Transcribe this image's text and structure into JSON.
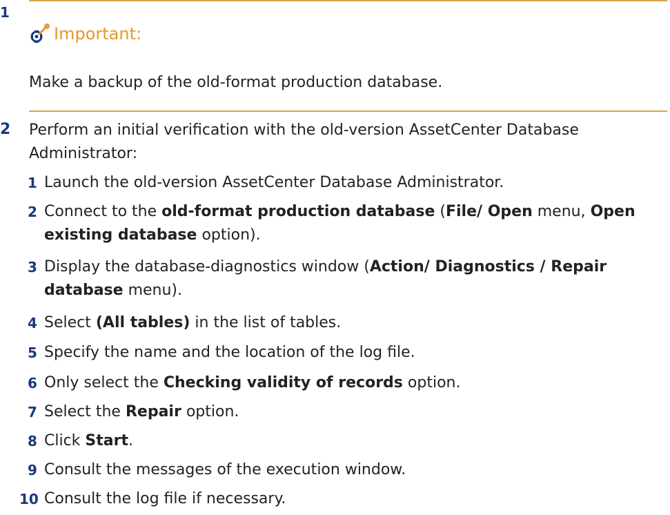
{
  "step1": {
    "number": "1",
    "note_label": "Important:",
    "note_icon": "wrench-gear-icon",
    "note_text": "Make a backup of the old-format production database."
  },
  "step2": {
    "number": "2",
    "intro": "Perform an initial verification with the old-version AssetCenter Database Administrator:",
    "substeps": [
      {
        "n": "1",
        "parts": [
          "Launch the old-version AssetCenter Database Administrator."
        ]
      },
      {
        "n": "2",
        "a": "Connect to the ",
        "b": "old-format production database",
        "c": " (",
        "d": "File/ Open",
        "e": " menu, ",
        "f": "Open existing database",
        "g": " option)."
      },
      {
        "n": "3",
        "a": "Display the database-diagnostics window (",
        "b": "Action/ Diagnostics / Repair database",
        "c": " menu)."
      },
      {
        "n": "4",
        "a": "Select ",
        "b": "(All tables)",
        "c": " in the list of tables."
      },
      {
        "n": "5",
        "a": "Specify the name and the location of the log file."
      },
      {
        "n": "6",
        "a": "Only select the ",
        "b": "Checking validity of records",
        "c": " option."
      },
      {
        "n": "7",
        "a": "Select the ",
        "b": "Repair",
        "c": " option."
      },
      {
        "n": "8",
        "a": "Click ",
        "b": "Start",
        "c": "."
      },
      {
        "n": "9",
        "a": "Consult the messages of the execution window."
      },
      {
        "n": "10",
        "a": "Consult the log file if necessary."
      }
    ]
  },
  "colors": {
    "step_number": "#1a3a7a",
    "important_label": "#e8962a",
    "rule": "#d8a24a"
  }
}
